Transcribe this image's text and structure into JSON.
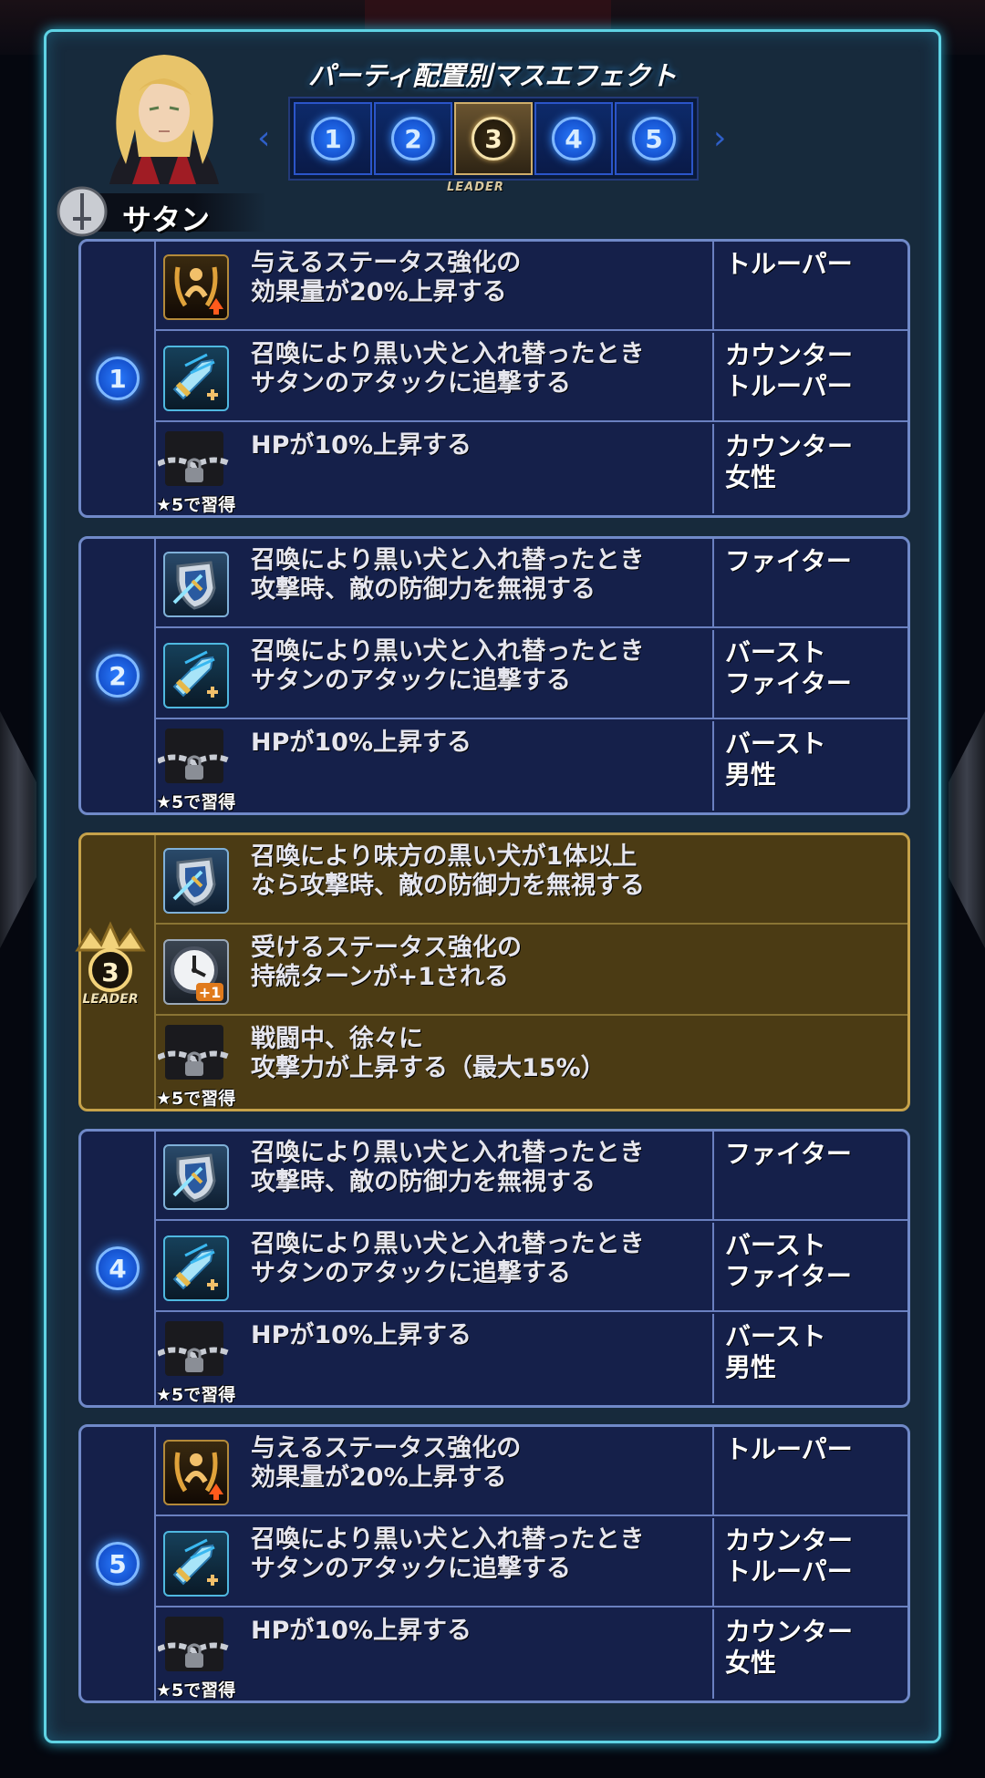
{
  "header": {
    "title": "パーティ配置別マスエフェクト",
    "character_name": "サタン",
    "weapon_icon": "sword-class-icon",
    "slots": [
      {
        "label": "1",
        "active": false
      },
      {
        "label": "2",
        "active": false
      },
      {
        "label": "3",
        "active": true
      },
      {
        "label": "4",
        "active": false
      },
      {
        "label": "5",
        "active": false
      }
    ],
    "active_slot_caption": "LEADER"
  },
  "lock_label": "★5で習得",
  "groups": [
    {
      "number": "1",
      "rows": [
        {
          "icon": "buff-up-icon",
          "desc": "与えるステータス強化の\n効果量が20%上昇する",
          "cond": "トルーパー"
        },
        {
          "icon": "sword-chase-icon",
          "desc": "召喚により黒い犬と入れ替ったとき\nサタンのアタックに追撃する",
          "cond": "カウンター\nトルーパー"
        },
        {
          "icon": "chain-lock-icon",
          "desc": "HPが10%上昇する",
          "cond": "カウンター\n女性",
          "locked": true
        }
      ]
    },
    {
      "number": "2",
      "rows": [
        {
          "icon": "shield-break-icon",
          "desc": "召喚により黒い犬と入れ替ったとき\n攻撃時、敵の防御力を無視する",
          "cond": "ファイター"
        },
        {
          "icon": "sword-chase-icon",
          "desc": "召喚により黒い犬と入れ替ったとき\nサタンのアタックに追撃する",
          "cond": "バースト\nファイター"
        },
        {
          "icon": "chain-lock-icon",
          "desc": "HPが10%上昇する",
          "cond": "バースト\n男性",
          "locked": true
        }
      ]
    },
    {
      "number": "3",
      "leader": true,
      "leader_caption": "LEADER",
      "rows": [
        {
          "icon": "shield-break-icon",
          "desc": "召喚により味方の黒い犬が1体以上\nなら攻撃時、敵の防御力を無視する",
          "cond": ""
        },
        {
          "icon": "clock-plus-icon",
          "desc": "受けるステータス強化の\n持続ターンが+1される",
          "cond": "",
          "icon_text": "+1"
        },
        {
          "icon": "chain-lock-icon",
          "desc": "戦闘中、徐々に\n攻撃力が上昇する（最大15%）",
          "cond": "",
          "locked": true
        }
      ]
    },
    {
      "number": "4",
      "rows": [
        {
          "icon": "shield-break-icon",
          "desc": "召喚により黒い犬と入れ替ったとき\n攻撃時、敵の防御力を無視する",
          "cond": "ファイター"
        },
        {
          "icon": "sword-chase-icon",
          "desc": "召喚により黒い犬と入れ替ったとき\nサタンのアタックに追撃する",
          "cond": "バースト\nファイター"
        },
        {
          "icon": "chain-lock-icon",
          "desc": "HPが10%上昇する",
          "cond": "バースト\n男性",
          "locked": true
        }
      ]
    },
    {
      "number": "5",
      "rows": [
        {
          "icon": "buff-up-icon",
          "desc": "与えるステータス強化の\n効果量が20%上昇する",
          "cond": "トルーパー"
        },
        {
          "icon": "sword-chase-icon",
          "desc": "召喚により黒い犬と入れ替ったとき\nサタンのアタックに追撃する",
          "cond": "カウンター\nトルーパー"
        },
        {
          "icon": "chain-lock-icon",
          "desc": "HPが10%上昇する",
          "cond": "カウンター\n女性",
          "locked": true
        }
      ]
    }
  ]
}
